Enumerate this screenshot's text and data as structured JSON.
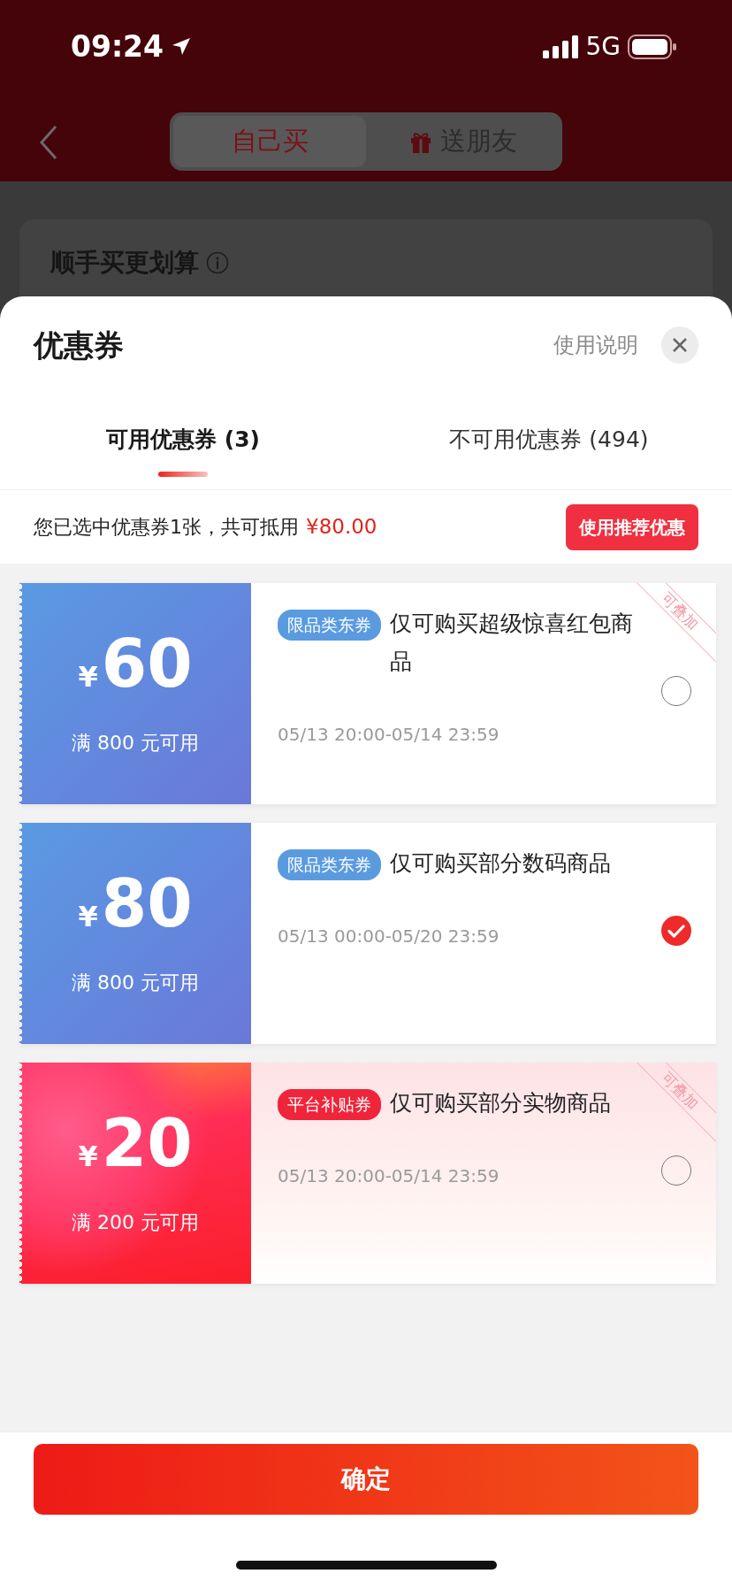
{
  "status_bar": {
    "time": "09:24",
    "network": "5G"
  },
  "background_page": {
    "tabs": [
      {
        "label": "自己买",
        "selected": true,
        "kind": "plain"
      },
      {
        "label": "送朋友",
        "selected": false,
        "kind": "gift"
      }
    ],
    "section_title": "顺手买更划算"
  },
  "sheet": {
    "title": "优惠券",
    "help_link": "使用说明",
    "tabs": [
      {
        "label": "可用优惠券 (3)",
        "selected": true
      },
      {
        "label": "不可用优惠券 (494)",
        "selected": false
      }
    ],
    "summary": {
      "text": "您已选中优惠券1张，共可抵用",
      "amount": "¥80.00"
    },
    "recommend_button": "使用推荐优惠",
    "coupons": [
      {
        "kind": "blue",
        "currency": "¥",
        "amount": "60",
        "condition": "满 800 元可用",
        "tag": "限品类东券",
        "description": "仅可购买超级惊喜红包商品",
        "validity": "05/13 20:00-05/14 23:59",
        "stackable_badge": "可叠加",
        "selected": false
      },
      {
        "kind": "blue",
        "currency": "¥",
        "amount": "80",
        "condition": "满 800 元可用",
        "tag": "限品类东券",
        "description": "仅可购买部分数码商品",
        "validity": "05/13 00:00-05/20 23:59",
        "selected": true
      },
      {
        "kind": "red",
        "currency": "¥",
        "amount": "20",
        "condition": "满 200 元可用",
        "tag": "平台补贴券",
        "description": "仅可购买部分实物商品",
        "validity": "05/13 20:00-05/14 23:59",
        "stackable_badge": "可叠加",
        "selected": false
      }
    ],
    "confirm_button": "确定"
  }
}
